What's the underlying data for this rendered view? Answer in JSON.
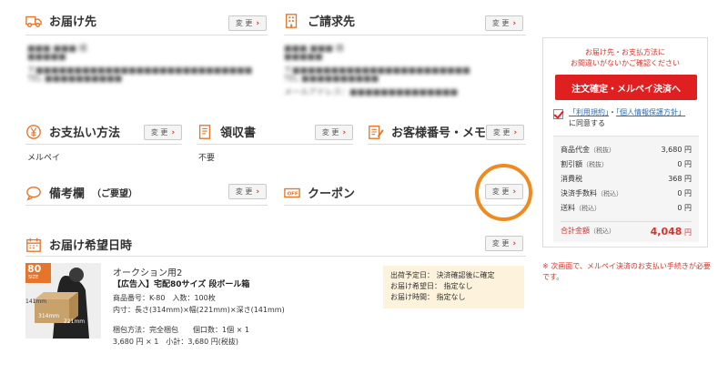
{
  "common": {
    "change_label": "変 更",
    "chevron": "›"
  },
  "delivery": {
    "title": "お届け先"
  },
  "billing": {
    "title": "ご請求先"
  },
  "payment": {
    "title": "お支払い方法",
    "value": "メルペイ"
  },
  "receipt": {
    "title": "領収書",
    "value": "不要"
  },
  "customer_number": {
    "title": "お客様番号・メモ"
  },
  "remarks": {
    "title": "備考欄",
    "title_note": "（ご要望）"
  },
  "coupon": {
    "title": "クーポン"
  },
  "delivery_date": {
    "title": "お届け希望日時"
  },
  "product": {
    "category": "オークション用2",
    "name": "【広告入】宅配80サイズ 段ボール箱",
    "code_line": "商品番号：K-80　入数：100枚",
    "size_line": "内寸：長さ(314mm)×幅(221mm)×深さ(141mm)",
    "pack_line": "梱包方法：完全梱包　　個口数：1個 × 1",
    "price_line": "3,680 円 × 1　小計：3,680 円(税抜)",
    "badge_num": "80",
    "badge_sub": "SIZE",
    "dim_a": "141mm",
    "dim_b": "314mm",
    "dim_c": "221mm"
  },
  "shipping": {
    "row1_label": "出荷予定日：",
    "row1_value": "決済確認後に確定",
    "row2_label": "お届け希望日：",
    "row2_value": "指定なし",
    "row3_label": "お届け時間：",
    "row3_value": "指定なし"
  },
  "order_panel": {
    "notice_line1": "お届け先・お支払方法に",
    "notice_line2": "お間違いがないかご確認ください",
    "confirm_button": "注文確定・メルペイ決済へ",
    "agree_link1": "「利用規約」",
    "agree_sep": "・",
    "agree_link2": "「個人情報保護方針」",
    "agree_suffix": "に同意する"
  },
  "summary": {
    "subtotal_label": "商品代金",
    "subtotal_note": "（税抜）",
    "subtotal_value": "3,680 円",
    "discount_label": "割引額",
    "discount_note": "（税抜）",
    "discount_value": "0 円",
    "tax_label": "消費税",
    "tax_value": "368 円",
    "fee_label": "決済手数料",
    "fee_note": "（税込）",
    "fee_value": "0 円",
    "shipping_label": "送料",
    "shipping_note": "（税込）",
    "shipping_value": "0 円",
    "total_label": "合計金額",
    "total_note": "（税込）",
    "total_value": "4,048",
    "total_unit": "円"
  },
  "footnote": "※ 次画面で、メルペイ決済のお支払い手続きが必要です。",
  "colors": {
    "accent": "#e02020",
    "highlight": "#f08a1e",
    "link": "#2a6fbd"
  }
}
